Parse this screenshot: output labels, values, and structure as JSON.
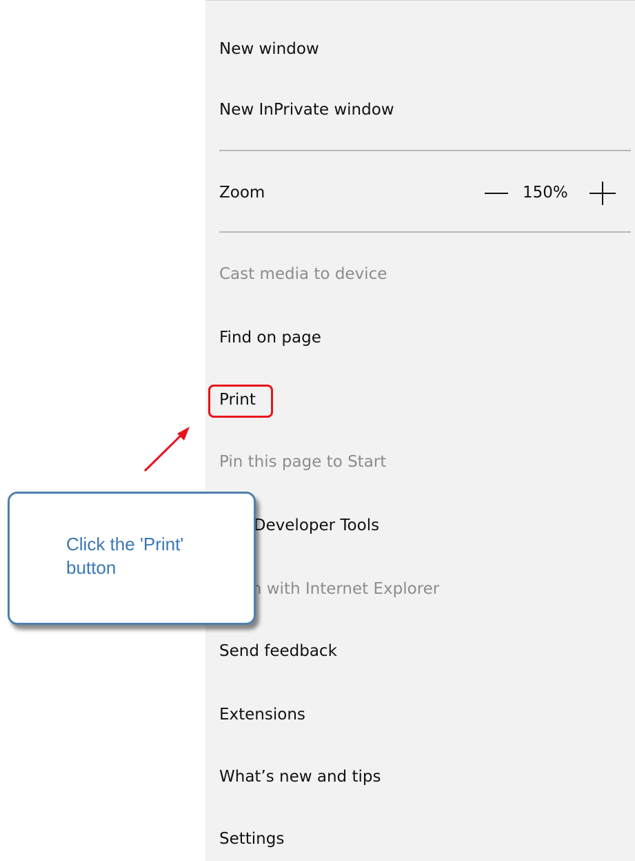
{
  "menu": {
    "new_window": "New window",
    "new_inprivate_window": "New InPrivate window",
    "zoom": {
      "label": "Zoom",
      "value": "150%",
      "decrease_icon": "minus-icon",
      "increase_icon": "plus-icon"
    },
    "cast_media": "Cast media to device",
    "find_on_page": "Find on page",
    "print": "Print",
    "pin_to_start": "Pin this page to Start",
    "developer_tools": "F12 Developer Tools",
    "open_with_ie": "Open with Internet Explorer",
    "send_feedback": "Send feedback",
    "extensions": "Extensions",
    "whats_new": "What’s new and tips",
    "settings": "Settings"
  },
  "callout": {
    "text": "Click the 'Print' button"
  },
  "colors": {
    "highlight": "#e8121a",
    "callout_border": "#4e7fae",
    "callout_text": "#3a78b7",
    "menu_background": "#f2f2f2",
    "disabled_text": "#8c8c8c"
  }
}
